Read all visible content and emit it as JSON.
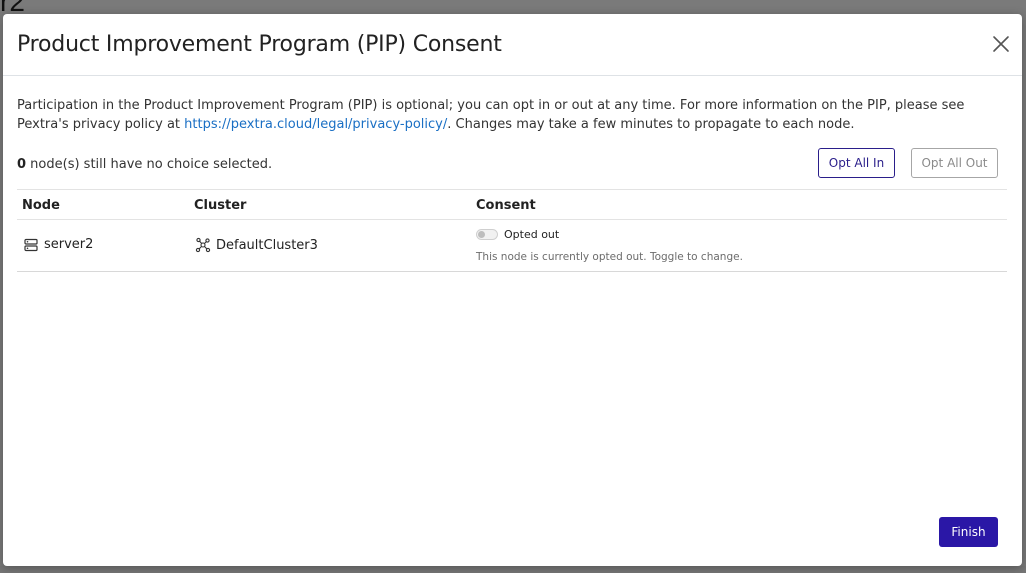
{
  "background": {
    "title_fragment": "r2"
  },
  "modal": {
    "title": "Product Improvement Program (PIP) Consent",
    "close_icon": "close-icon",
    "description": {
      "text_before": "Participation in the Product Improvement Program (PIP) is optional; you can opt in or out at any time. For more information on the PIP, please see Pextra's privacy policy at ",
      "link": "https://pextra.cloud/legal/privacy-policy/",
      "text_after": ". Changes may take a few minutes to propagate to each node."
    },
    "pending": {
      "count": "0",
      "text": " node(s) still have no choice selected."
    },
    "buttons": {
      "opt_all_in": "Opt All In",
      "opt_all_out": "Opt All Out",
      "finish": "Finish"
    },
    "table": {
      "headers": {
        "node": "Node",
        "cluster": "Cluster",
        "consent": "Consent"
      },
      "rows": [
        {
          "node": "server2",
          "node_icon": "server-icon",
          "cluster": "DefaultCluster3",
          "cluster_icon": "cluster-icon",
          "consent_state": "Opted out",
          "consent_on": false,
          "consent_hint": "This node is currently opted out. Toggle to change."
        }
      ]
    }
  },
  "colors": {
    "primary": "#2a17a6",
    "link": "#1a6fc4",
    "overlay": "#7a7a7a"
  }
}
